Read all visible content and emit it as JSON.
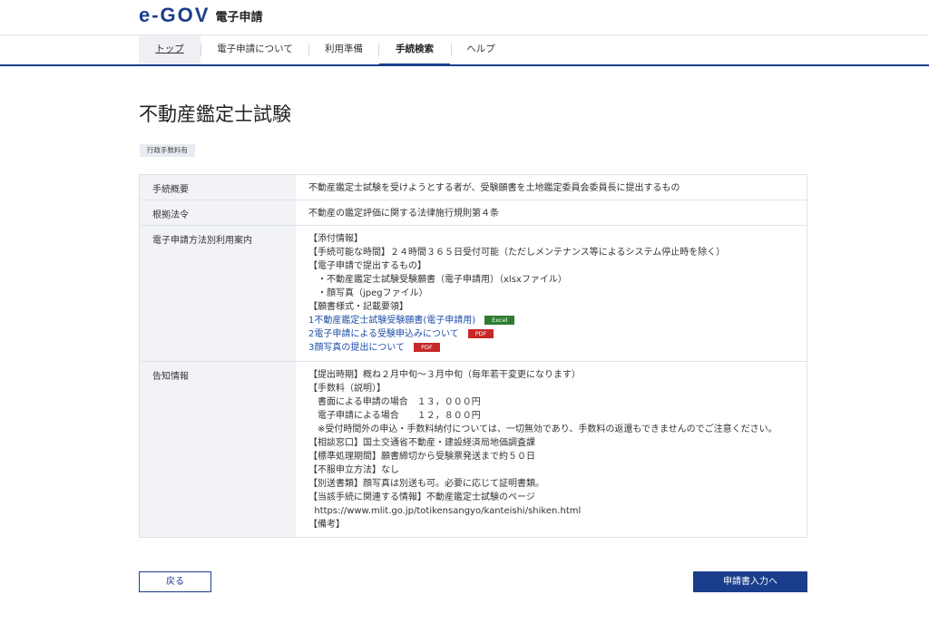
{
  "header": {
    "logo_text": "e-GOV",
    "logo_sub": "電子申請"
  },
  "nav": {
    "items": [
      {
        "label": "トップ"
      },
      {
        "label": "電子申請について"
      },
      {
        "label": "利用準備"
      },
      {
        "label": "手続検索"
      },
      {
        "label": "ヘルプ"
      }
    ]
  },
  "page": {
    "title": "不動産鑑定士試験",
    "badge": "行政手数料有"
  },
  "table": {
    "overview": {
      "label": "手続概要",
      "value": "不動産鑑定士試験を受けようとする者が、受験願書を土地鑑定委員会委員長に提出するもの"
    },
    "law": {
      "label": "根拠法令",
      "value": "不動産の鑑定評価に関する法律施行規則第４条"
    },
    "guide": {
      "label": "電子申請方法別利用案内",
      "lines": [
        "【添付情報】",
        "【手続可能な時間】２４時間３６５日受付可能（ただしメンテナンス等によるシステム停止時を除く）",
        "【電子申請で提出するもの】",
        "　・不動産鑑定士試験受験願書（電子申請用）（xlsxファイル）",
        "　・顔写真（jpegファイル）",
        "【願書様式・記載要領】"
      ],
      "links": [
        {
          "text": "1不動産鑑定士試験受験願書(電子申請用)",
          "tag": "Excel"
        },
        {
          "text": "2電子申請による受験申込みについて",
          "tag": "PDF"
        },
        {
          "text": "3顔写真の提出について",
          "tag": "PDF"
        }
      ]
    },
    "notice": {
      "label": "告知情報",
      "lines": [
        "【提出時期】概ね２月中旬～３月中旬（毎年若干変更になります）",
        "【手数料（説明）】",
        "　書面による申請の場合　１３，０００円",
        "　電子申請による場合　　１２，８００円",
        "　※受付時間外の申込・手数料納付については、一切無効であり、手数料の返還もできませんのでご注意ください。",
        "【相談窓口】国土交通省不動産・建設経済局地価調査課",
        "【標準処理期間】願書締切から受験票発送まで約５０日",
        "【不服申立方法】なし",
        "【別送書類】顔写真は別送も可。必要に応じて証明書類。",
        "【当該手続に関連する情報】不動産鑑定士試験のページ",
        "  https://www.mlit.go.jp/totikensangyo/kanteishi/shiken.html",
        "【備考】"
      ]
    }
  },
  "buttons": {
    "back": "戻る",
    "next": "申請書入力へ"
  },
  "colors": {
    "brand": "#1a3e8c",
    "excel_tag": "#2e7d32",
    "pdf_tag": "#c62828"
  }
}
